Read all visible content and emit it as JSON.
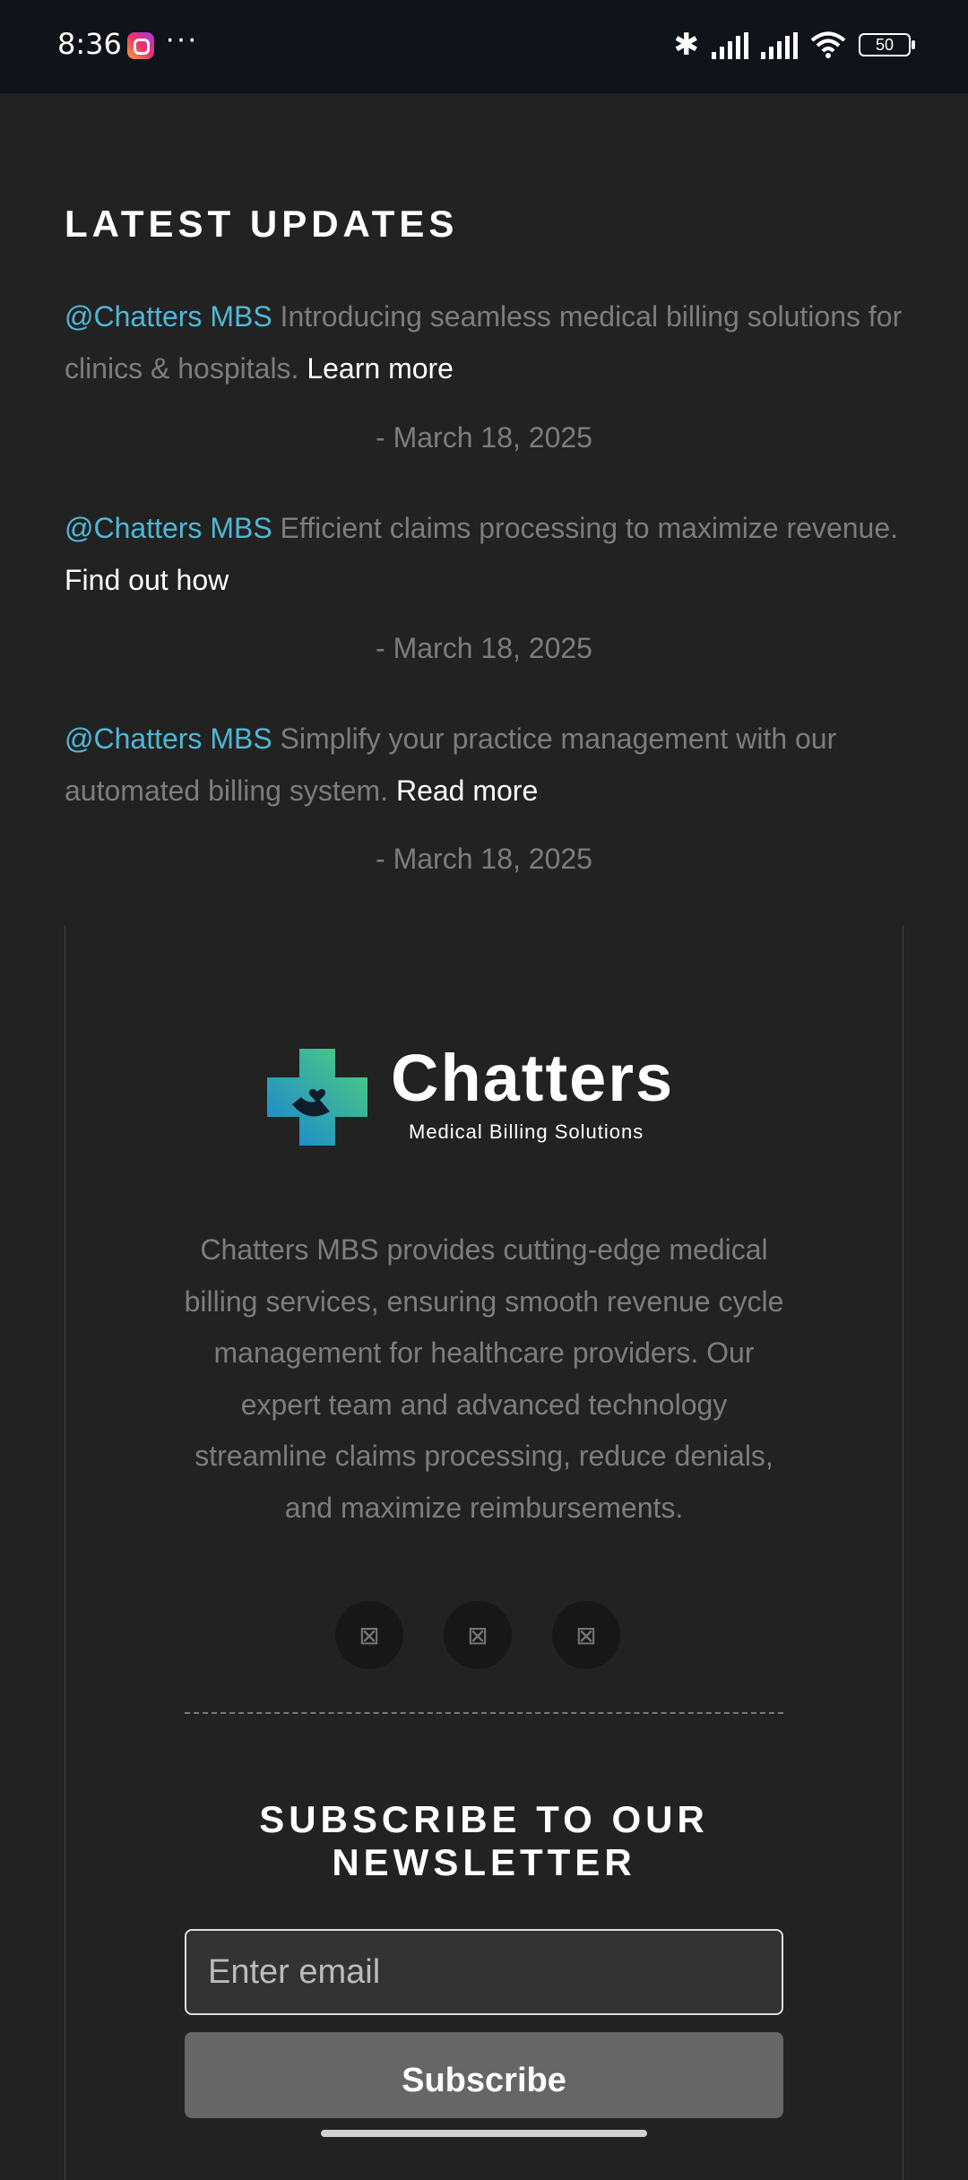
{
  "status_bar": {
    "time": "8:36",
    "more": "···",
    "battery": "50",
    "icons": [
      "instagram-icon",
      "bluetooth-icon",
      "signal-icon",
      "signal-icon",
      "wifi-icon",
      "battery-icon"
    ]
  },
  "updates": {
    "title": "LATEST UPDATES",
    "items": [
      {
        "mention": "@Chatters MBS",
        "text": " Introducing seamless medical billing solutions for clinics & hospitals. ",
        "link": "Learn more",
        "date": "- March 18, 2025"
      },
      {
        "mention": "@Chatters MBS",
        "text": " Efficient claims processing to maximize revenue. ",
        "link": "Find out how",
        "date": "- March 18, 2025"
      },
      {
        "mention": "@Chatters MBS",
        "text": " Simplify your practice management with our automated billing system. ",
        "link": "Read more",
        "date": "- March 18, 2025"
      }
    ]
  },
  "footer": {
    "logo_title": "Chatters",
    "logo_subtitle": "Medical Billing Solutions",
    "about": "Chatters MBS provides cutting-edge medical billing services, ensuring smooth revenue cycle management for healthcare providers. Our expert team and advanced technology streamline claims processing, reduce denials, and maximize reimbursements.",
    "social_glyph": "⊠",
    "newsletter_title": "SUBSCRIBE TO OUR NEWSLETTER",
    "email_placeholder": "Enter email",
    "subscribe_label": "Subscribe"
  },
  "colors": {
    "background": "#222222",
    "accent": "#4fb8d6",
    "muted_text": "#7d7d7d"
  }
}
